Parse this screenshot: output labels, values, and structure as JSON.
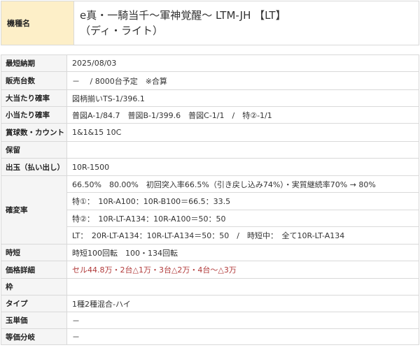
{
  "header": {
    "label": "機種名",
    "title_line1": "e真・一騎当千～軍神覚醒～ LTM-JH 【LT】",
    "title_line2": "（ディ・ライト）"
  },
  "specs": {
    "release": {
      "label": "最短納期",
      "value": "2025/08/03"
    },
    "sales": {
      "label": "販売台数",
      "value": "－　 / 8000台予定　※合算"
    },
    "big_prob": {
      "label": "大当たり確率",
      "value": "図柄揃いTS-1/396.1"
    },
    "small_prob": {
      "label": "小当たり確率",
      "value": "普図A-1/84.7　普図B-1/399.6　普図C-1/1　/　特②-1/1"
    },
    "prize_count": {
      "label": "賞球数・カウント",
      "value": "1&1&15 10C"
    },
    "hold": {
      "label": "保留",
      "value": ""
    },
    "payout": {
      "label": "出玉（払い出し）",
      "value": "10R-1500"
    },
    "kakuhen": {
      "label": "確変率",
      "lines": [
        "66.50%　80.00%　初回突入率66.5%（引き戻し込み74%）・実質継続率70% → 80%",
        "特①：　10R-A100：10R-B100＝66.5：33.5",
        "特②：　10R-LT-A134：10R-A100＝50：50",
        "LT：　20R-LT-A134：10R-LT-A134＝50：50　/　時短中：　全て10R-LT-A134"
      ]
    },
    "jitan": {
      "label": "時短",
      "value": "時短100回転　100・134回転"
    },
    "price": {
      "label": "価格詳細",
      "value": "セル44.8万・2台△1万・3台△2万・4台～△3万"
    },
    "frame": {
      "label": "枠",
      "value": ""
    },
    "type": {
      "label": "タイプ",
      "value": "1種2種混合-ハイ"
    },
    "ball_price": {
      "label": "玉単価",
      "value": "－"
    },
    "break_even": {
      "label": "等価分岐",
      "value": "－"
    }
  },
  "colors": {
    "title_label_bg": "#fdefc8",
    "spec_label_bg": "#f5f5f5",
    "border": "#d9d9d9",
    "price_text": "#b13a3a"
  }
}
